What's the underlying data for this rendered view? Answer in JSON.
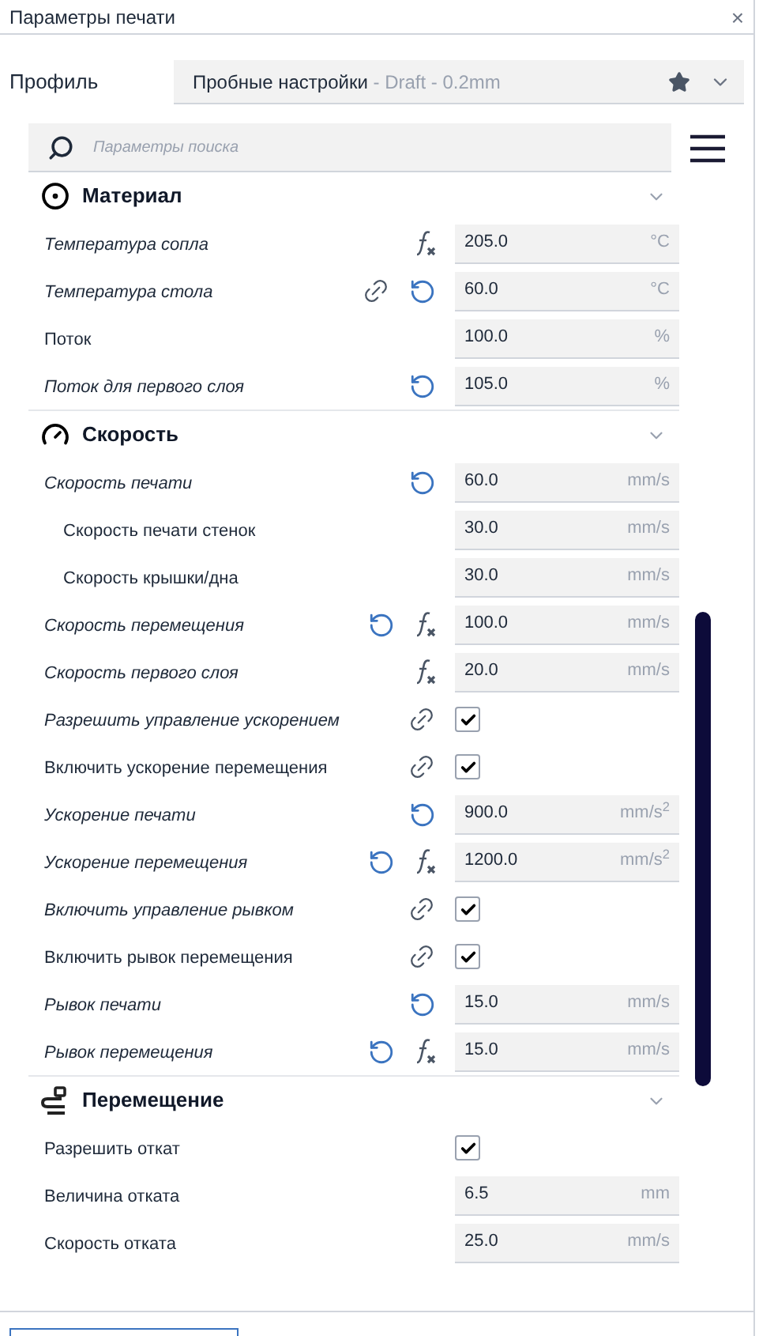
{
  "window": {
    "title": "Параметры печати",
    "close": "×"
  },
  "profile": {
    "label": "Профиль",
    "name": "Пробные настройки",
    "detail": " - Draft - 0.2mm",
    "favorite": true
  },
  "search": {
    "placeholder": "Параметры поиска"
  },
  "sections": [
    {
      "title": "Материал",
      "expanded": true,
      "rows": [
        {
          "kind": "number",
          "label": "Температура сопла",
          "italic": true,
          "linked": false,
          "resettable": false,
          "formula": true,
          "value": "205.0",
          "unit": "°C"
        },
        {
          "kind": "number",
          "label": "Температура стола",
          "italic": true,
          "linked": true,
          "resettable": true,
          "formula": false,
          "value": "60.0",
          "unit": "°C"
        },
        {
          "kind": "number",
          "label": "Поток",
          "italic": false,
          "linked": false,
          "resettable": false,
          "formula": false,
          "value": "100.0",
          "unit": "%"
        },
        {
          "kind": "number",
          "label": "Поток для первого слоя",
          "italic": true,
          "linked": false,
          "resettable": true,
          "formula": false,
          "value": "105.0",
          "unit": "%"
        }
      ]
    },
    {
      "title": "Скорость",
      "expanded": true,
      "rows": [
        {
          "kind": "number",
          "label": "Скорость печати",
          "italic": true,
          "linked": false,
          "resettable": true,
          "formula": false,
          "value": "60.0",
          "unit": "mm/s",
          "children": [
            {
              "kind": "number",
              "label": "Скорость печати стенок",
              "italic": false,
              "linked": false,
              "resettable": false,
              "formula": false,
              "value": "30.0",
              "unit": "mm/s"
            },
            {
              "kind": "number",
              "label": "Скорость крышки/дна",
              "italic": false,
              "linked": false,
              "resettable": false,
              "formula": false,
              "value": "30.0",
              "unit": "mm/s"
            }
          ]
        },
        {
          "kind": "number",
          "label": "Скорость перемещения",
          "italic": true,
          "linked": false,
          "resettable": true,
          "formula": true,
          "value": "100.0",
          "unit": "mm/s"
        },
        {
          "kind": "number",
          "label": "Скорость первого слоя",
          "italic": true,
          "linked": false,
          "resettable": false,
          "formula": true,
          "value": "20.0",
          "unit": "mm/s"
        },
        {
          "kind": "checkbox",
          "label": "Разрешить управление ускорением",
          "italic": true,
          "linked": true,
          "resettable": false,
          "formula": false,
          "checked": true
        },
        {
          "kind": "checkbox",
          "label": "Включить ускорение перемещения",
          "italic": false,
          "linked": true,
          "resettable": false,
          "formula": false,
          "checked": true
        },
        {
          "kind": "number",
          "label": "Ускорение печати",
          "italic": true,
          "linked": false,
          "resettable": true,
          "formula": false,
          "value": "900.0",
          "unit": "mm/s$^{2}$"
        },
        {
          "kind": "number",
          "label": "Ускорение перемещения",
          "italic": true,
          "linked": false,
          "resettable": true,
          "formula": true,
          "value": "1200.0",
          "unit": "mm/s$^{2}$"
        },
        {
          "kind": "checkbox",
          "label": "Включить управление рывком",
          "italic": true,
          "linked": true,
          "resettable": false,
          "formula": false,
          "checked": true
        },
        {
          "kind": "checkbox",
          "label": "Включить рывок перемещения",
          "italic": false,
          "linked": true,
          "resettable": false,
          "formula": false,
          "checked": true
        },
        {
          "kind": "number",
          "label": "Рывок печати",
          "italic": true,
          "linked": false,
          "resettable": true,
          "formula": false,
          "value": "15.0",
          "unit": "mm/s"
        },
        {
          "kind": "number",
          "label": "Рывок перемещения",
          "italic": true,
          "linked": false,
          "resettable": true,
          "formula": true,
          "value": "15.0",
          "unit": "mm/s"
        }
      ]
    },
    {
      "title": "Перемещение",
      "expanded": true,
      "rows": [
        {
          "kind": "checkbox",
          "label": "Разрешить откат",
          "italic": false,
          "linked": false,
          "resettable": false,
          "formula": false,
          "checked": true
        },
        {
          "kind": "number",
          "label": "Величина отката",
          "italic": false,
          "linked": false,
          "resettable": false,
          "formula": false,
          "value": "6.5",
          "unit": "mm"
        },
        {
          "kind": "number",
          "label": "Скорость отката",
          "italic": false,
          "linked": false,
          "resettable": false,
          "formula": false,
          "value": "25.0",
          "unit": "mm/s"
        }
      ]
    }
  ]
}
